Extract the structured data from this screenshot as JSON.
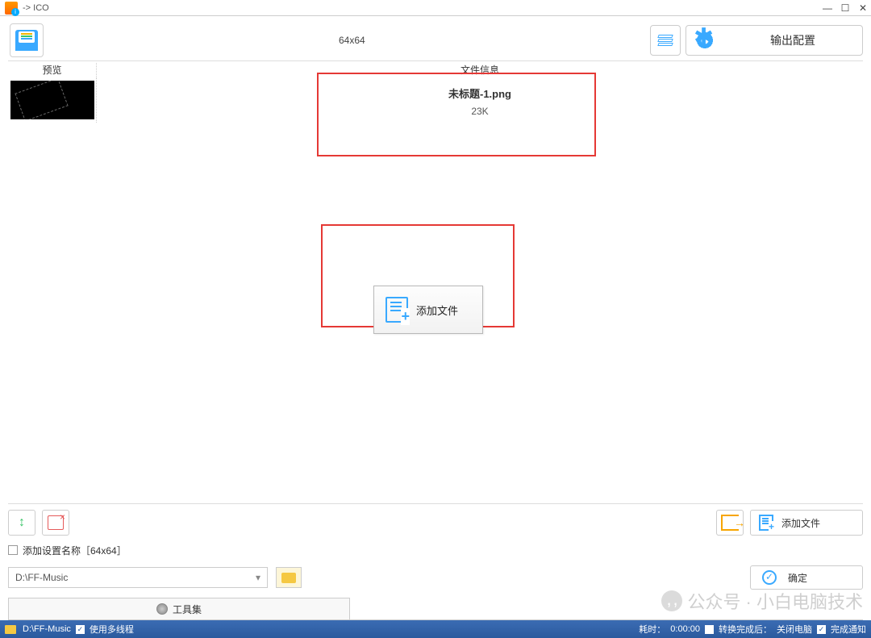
{
  "titlebar": {
    "title": " -> ICO"
  },
  "toolbar": {
    "size_label": "64x64",
    "output_label": "输出配置"
  },
  "headers": {
    "preview": "预览",
    "info": "文件信息"
  },
  "file": {
    "name": "未标题-1.png",
    "size": "23K"
  },
  "add_file": {
    "label": "添加文件"
  },
  "bottom": {
    "add_config_name": "添加设置名称［64x64］",
    "add_file_label": "添加文件",
    "path": "D:\\FF-Music",
    "confirm": "确定"
  },
  "app_tab": {
    "label": "工具集"
  },
  "watermark": {
    "text": "公众号 · 小白电脑技术"
  },
  "statusbar": {
    "path": "D:\\FF-Music",
    "multithread": "使用多线程",
    "elapsed_label": "耗时：",
    "elapsed_value": "0:00:00",
    "after_label": "转换完成后：",
    "after_value": "关闭电脑",
    "notify": "完成通知"
  }
}
